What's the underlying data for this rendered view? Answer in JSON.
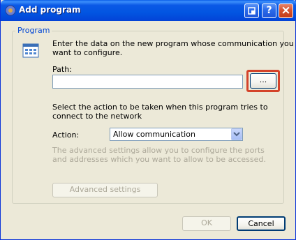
{
  "window": {
    "title": "Add program"
  },
  "titlebar_buttons": {
    "help": "?",
    "close": "×"
  },
  "group": {
    "label": "Program",
    "intro_line1": "Enter the data on the new program whose communication you",
    "intro_line2": "want to configure.",
    "path_label": "Path:",
    "path_value": "",
    "browse_label": "...",
    "action_intro_line1": "Select the action to be taken when this program tries to",
    "action_intro_line2": "connect to the network",
    "action_label": "Action:",
    "action_selected": "Allow communication",
    "advanced_text_line1": "The advanced settings allow you to configure the ports",
    "advanced_text_line2": "and addresses which you want to allow to be accessed.",
    "advanced_button": "Advanced settings"
  },
  "footer": {
    "ok": "OK",
    "cancel": "Cancel"
  },
  "colors": {
    "titlebar": "#0255e1",
    "group_label": "#0046d5",
    "highlight": "#d4432a",
    "disabled_text": "#aca899"
  }
}
